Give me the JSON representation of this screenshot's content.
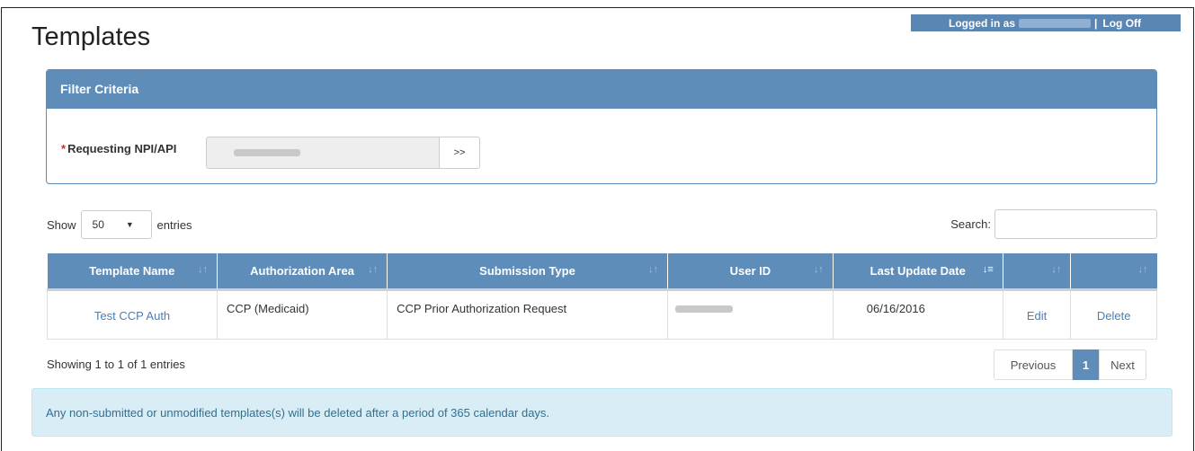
{
  "header": {
    "title": "Templates",
    "logged_in_label": "Logged in as",
    "separator": "|",
    "logoff_label": "Log Off"
  },
  "filter": {
    "panel_title": "Filter Criteria",
    "required_marker": "*",
    "npi_label": "Requesting NPI/API",
    "go_button": ">>"
  },
  "table_controls": {
    "show_label": "Show",
    "entries_value": "50",
    "entries_label": "entries",
    "search_label": "Search:"
  },
  "table": {
    "columns": [
      "Template Name",
      "Authorization Area",
      "Submission Type",
      "User ID",
      "Last Update Date",
      "",
      ""
    ],
    "rows": [
      {
        "template_name": "Test CCP Auth",
        "authorization_area": "CCP (Medicaid)",
        "submission_type": "CCP Prior Authorization Request",
        "last_update_date": "06/16/2016",
        "edit": "Edit",
        "delete": "Delete"
      }
    ]
  },
  "footer": {
    "showing": "Showing 1 to 1 of 1 entries",
    "previous": "Previous",
    "page": "1",
    "next": "Next"
  },
  "notice": "Any non-submitted or unmodified templates(s) will be deleted after a period of 365 calendar days.",
  "colors": {
    "header_blue": "#5f8db9",
    "link_blue": "#4a7fb4",
    "alert_bg": "#d9edf7",
    "alert_text": "#31708f",
    "required_red": "#c9302c"
  }
}
